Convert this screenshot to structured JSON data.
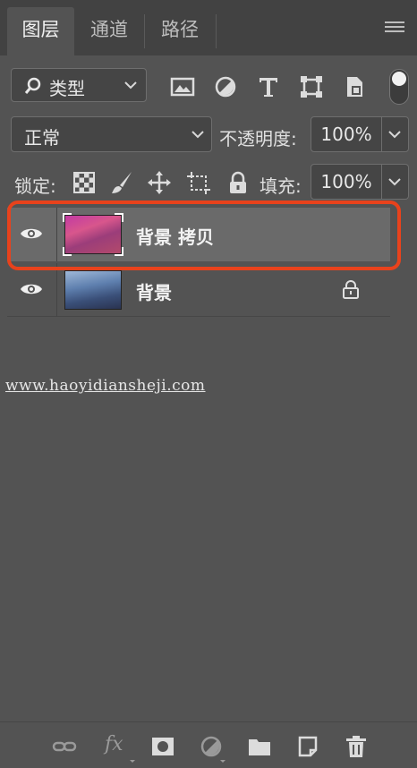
{
  "tabs": [
    {
      "label": "图层",
      "active": true
    },
    {
      "label": "通道",
      "active": false
    },
    {
      "label": "路径",
      "active": false
    }
  ],
  "filter": {
    "kind_label": "类型",
    "icons": [
      "image-filter-icon",
      "adjustment-filter-icon",
      "type-filter-icon",
      "shape-filter-icon",
      "smart-object-filter-icon"
    ]
  },
  "blend": {
    "mode": "正常",
    "opacity_label": "不透明度:",
    "opacity_value": "100%"
  },
  "lock": {
    "label": "锁定:",
    "fill_label": "填充:",
    "fill_value": "100%"
  },
  "layers": [
    {
      "name": "背景 拷贝",
      "selected": true,
      "visible": true,
      "locked": false
    },
    {
      "name": "背景",
      "selected": false,
      "visible": true,
      "locked": true
    }
  ],
  "watermark": "www.haoyidiansheji.com",
  "bottom": {
    "fx_label": "fx"
  },
  "colors": {
    "panel": "#535353",
    "tabbar": "#424242",
    "selected_row": "#6a6a6a",
    "highlight": "#e8421c"
  }
}
